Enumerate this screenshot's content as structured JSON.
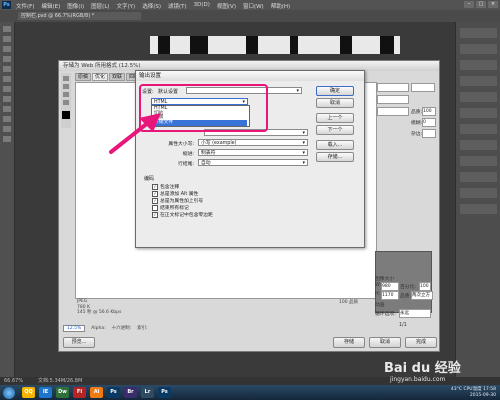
{
  "photoshop": {
    "logo": "Ps",
    "menu": [
      "文件(F)",
      "编辑(E)",
      "图像(I)",
      "图层(L)",
      "文字(Y)",
      "选择(S)",
      "滤镜(T)",
      "3D(D)",
      "视图(V)",
      "窗口(W)",
      "帮助(H)"
    ],
    "doc_tab": "控制栏.psd @ 66.7%(RGB/8) *",
    "status_left": "66.67%",
    "status_doc": "文档:5.34M/26.8M"
  },
  "save_for_web": {
    "title": "存储为 Web 所用格式 (12.5%)",
    "tabs": [
      "原稿",
      "优化",
      "双联",
      "四联"
    ],
    "active_tab": 1,
    "info_lines": [
      "JPEG",
      "780 K",
      "145 秒 @ 56.6 Kbps"
    ],
    "info_right": "100 品质",
    "zoom": "12.5%",
    "alpha_label": "Alpha:",
    "hex_label": "十六进制:",
    "index_label": "索引:",
    "preview_button": "预览...",
    "save_button": "存储",
    "cancel_button": "取消",
    "done_button": "完成",
    "right_panel": {
      "quality_label": "品质:",
      "quality_value": "100",
      "blur_label": "模糊:",
      "blur_value": "0",
      "matte_label": "杂边:",
      "image_size_label": "图像大小",
      "w_label": "W:",
      "w_value": "980",
      "h_label": "H:",
      "h_value": "1170",
      "percent_label": "百分比:",
      "percent_value": "100",
      "unit": "%",
      "quality_mode_label": "品质:",
      "quality_mode_value": "两次立方",
      "animation_label": "动画",
      "loop_label": "循环选项:",
      "loop_value": "永远",
      "page_indicator": "1/1"
    }
  },
  "output_settings": {
    "title": "输出设置",
    "settings_label": "设置:",
    "settings_value": "默认设置",
    "section_dropdown": {
      "selected": "HTML",
      "options": [
        "HTML",
        "切片",
        "背景",
        "存储文件"
      ],
      "highlighted_index": 3
    },
    "rows": [
      {
        "label": "属性大小写:",
        "value": "小写 (example)"
      },
      {
        "label": "缩进:",
        "value": "制表符"
      },
      {
        "label": "行结尾:",
        "value": "自动"
      }
    ],
    "encoding_label": "编码",
    "checkboxes": [
      {
        "label": "包含注释",
        "checked": true
      },
      {
        "label": "总是添加 Alt 属性",
        "checked": true
      },
      {
        "label": "总是为属性加上引号",
        "checked": true
      },
      {
        "label": "结束所有标记",
        "checked": false
      },
      {
        "label": "在正文标记中包含零边距",
        "checked": true
      }
    ],
    "buttons": {
      "ok": "确定",
      "cancel": "取消",
      "prev": "上一个",
      "next": "下一个",
      "load": "载入...",
      "save": "存储..."
    }
  },
  "taskbar": {
    "apps": [
      "QQ",
      "IE",
      "Dw",
      "Fl",
      "Ai",
      "Ps",
      "Br",
      "Lr",
      "Ps"
    ],
    "temperature": "43°C",
    "cpu_temp": "CPU温度",
    "time": "17:58",
    "date": "2015-09-30"
  },
  "watermark": {
    "main": "Bai du 经验",
    "sub": "jingyan.baidu.com"
  },
  "colors": {
    "annotation": "#e8157a",
    "highlight": "#3874d8"
  }
}
